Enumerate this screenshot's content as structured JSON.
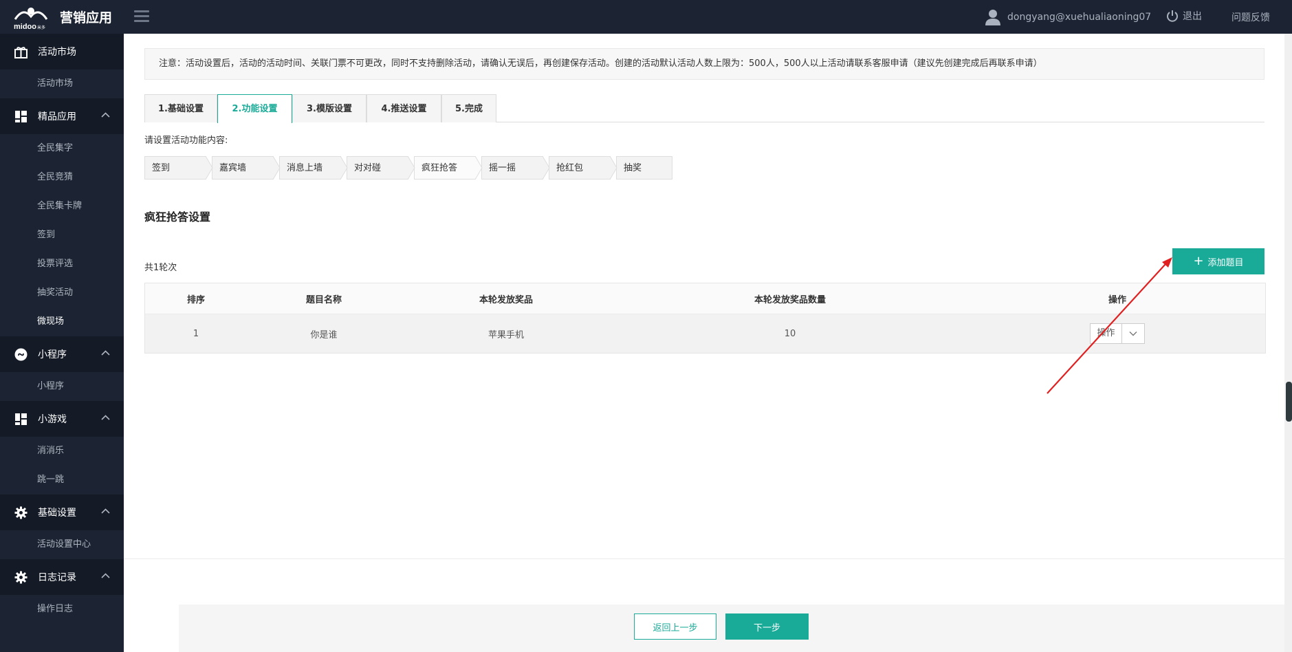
{
  "header": {
    "app_title": "营销应用",
    "user": "dongyang@xuehualiaoning07",
    "logout": "退出",
    "feedback": "问题反馈"
  },
  "sidebar": {
    "groups": [
      {
        "label": "活动市场",
        "icon": "grid-icon",
        "items": [
          "活动市场"
        ]
      },
      {
        "label": "精品应用",
        "icon": "apps-icon",
        "items": [
          "全民集字",
          "全民竞猜",
          "全民集卡牌",
          "签到",
          "投票评选",
          "抽奖活动",
          "微现场"
        ],
        "active_item": "微现场"
      },
      {
        "label": "小程序",
        "icon": "miniprogram-icon",
        "items": [
          "小程序"
        ]
      },
      {
        "label": "小游戏",
        "icon": "apps-icon",
        "items": [
          "消消乐",
          "跳一跳"
        ]
      },
      {
        "label": "基础设置",
        "icon": "gear-icon",
        "items": [
          "活动设置中心"
        ]
      },
      {
        "label": "日志记录",
        "icon": "gear-icon",
        "items": [
          "操作日志"
        ]
      }
    ]
  },
  "notice": "注意：活动设置后，活动的活动时间、关联门票不可更改，同时不支持删除活动，请确认无误后，再创建保存活动。创建的活动默认活动人数上限为：500人，500人以上活动请联系客服申请（建议先创建完成后再联系申请）",
  "tabs": [
    "1.基础设置",
    "2.功能设置",
    "3.模版设置",
    "4.推送设置",
    "5.完成"
  ],
  "active_tab": 1,
  "function_label": "请设置活动功能内容:",
  "steps": [
    "签到",
    "嘉宾墙",
    "消息上墙",
    "对对碰",
    "疯狂抢答",
    "摇一摇",
    "抢红包",
    "抽奖"
  ],
  "active_step": 4,
  "section_title": "疯狂抢答设置",
  "round_count": "共1轮次",
  "add_button": "添加题目",
  "table": {
    "headers": [
      "排序",
      "题目名称",
      "本轮发放奖品",
      "本轮发放奖品数量",
      "操作"
    ],
    "rows": [
      {
        "order": "1",
        "name": "你是谁",
        "prize": "苹果手机",
        "qty": "10",
        "action": "操作"
      }
    ]
  },
  "footer": {
    "back": "返回上一步",
    "next": "下一步"
  },
  "colors": {
    "accent": "#1aab98",
    "sidebar_bg": "#1c2433",
    "annotation_arrow": "#e02020"
  }
}
